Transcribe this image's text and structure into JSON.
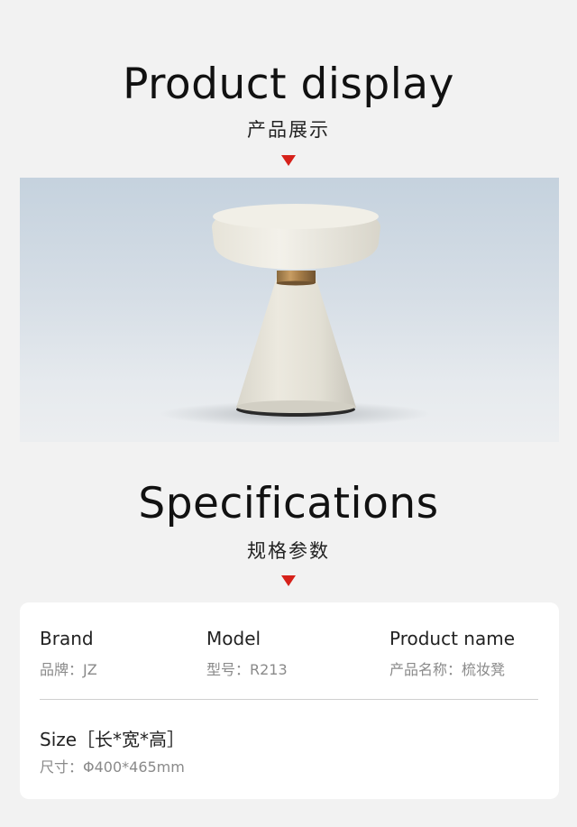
{
  "display": {
    "title": "Product display",
    "subtitle": "产品展示"
  },
  "specs": {
    "title": "Specifications",
    "subtitle": "规格参数",
    "brand_label": "Brand",
    "brand_value": "品牌：JZ",
    "model_label": "Model",
    "model_value": "型号：R213",
    "name_label": "Product name",
    "name_value": "产品名称：梳妆凳",
    "size_label": "Size［长*宽*高］",
    "size_value": "尺寸：Φ400*465mm"
  },
  "colors": {
    "accent": "#d6211a",
    "background": "#f2f2f2",
    "card": "#ffffff"
  },
  "icons": {
    "arrow": "down-triangle-icon"
  }
}
